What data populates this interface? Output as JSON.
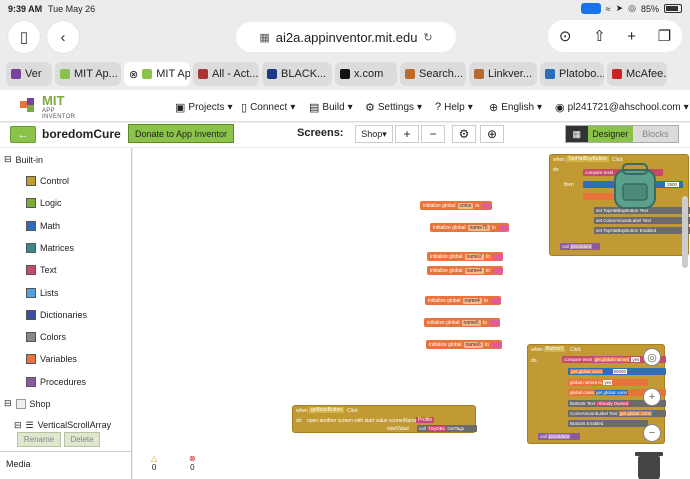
{
  "status": {
    "time": "9:39 AM",
    "date": "Tue May 26",
    "battery": "85%"
  },
  "browser": {
    "url": "ai2a.appinventor.mit.edu",
    "tabs": [
      {
        "label": "Ver",
        "color": "#7b3fa0",
        "close": false
      },
      {
        "label": "MIT Ap...",
        "color": "#8bc34a",
        "close": false
      },
      {
        "label": "MIT Ap...",
        "color": "#8bc34a",
        "close": true,
        "active": true
      },
      {
        "label": "All - Act...",
        "color": "#a33",
        "close": false
      },
      {
        "label": "BLACK...",
        "color": "#1a3a8a",
        "close": false
      },
      {
        "label": "x.com",
        "color": "#111",
        "close": false
      },
      {
        "label": "Search...",
        "color": "#c06a2a",
        "close": false
      },
      {
        "label": "Linkver...",
        "color": "#b86a2e",
        "close": false
      },
      {
        "label": "Platobo...",
        "color": "#2a6db8",
        "close": false
      },
      {
        "label": "McAfee...",
        "color": "#c22",
        "close": false
      }
    ]
  },
  "app": {
    "logo_title": "MIT",
    "logo_sub": "APP INVENTOR",
    "menu": {
      "projects": "Projects",
      "connect": "Connect",
      "build": "Build",
      "settings": "Settings",
      "help": "Help",
      "language": "English",
      "account": "pl241721@ahschool.com"
    },
    "project_name": "boredomCure",
    "donate": "Donate to App Inventor",
    "screens_label": "Screens:",
    "screen": "Shop",
    "designer": "Designer",
    "blocks": "Blocks"
  },
  "sidebar": {
    "builtin": "Built-in",
    "items": [
      {
        "label": "Control",
        "color": "#c29a34"
      },
      {
        "label": "Logic",
        "color": "#7cab3b"
      },
      {
        "label": "Math",
        "color": "#2f6db8"
      },
      {
        "label": "Matrices",
        "color": "#3a8a8a"
      },
      {
        "label": "Text",
        "color": "#c84a6a"
      },
      {
        "label": "Lists",
        "color": "#5aa0d8"
      },
      {
        "label": "Dictionaries",
        "color": "#3a4ea0"
      },
      {
        "label": "Colors",
        "color": "#888888"
      },
      {
        "label": "Variables",
        "color": "#e8743b"
      },
      {
        "label": "Procedures",
        "color": "#8e5a9e"
      }
    ],
    "shop": "Shop",
    "vsa": "VerticalScrollArray",
    "rename": "Rename",
    "delete": "Delete",
    "media": "Media"
  },
  "workspace": {
    "init_prefix": "initialize global",
    "to": "to",
    "globals": [
      "coins",
      "name75",
      "name2",
      "name4",
      "name4",
      "name5",
      "name6"
    ],
    "warnings": "0",
    "errors": "0",
    "evt1": {
      "when": "when",
      "comp": "TopHatBuyButton",
      "evt": "Click",
      "do": "do",
      "compare": "compare texts",
      "then": "then",
      "set": "set",
      "call": "call",
      "procedure": "procedure",
      "v": "2500",
      "r1": "TopHatBuyButton",
      "r1p": "Text",
      "r2": "CoinsAmountLabel",
      "r2p": "Text",
      "r3": "TopHatBuyButton",
      "r3p": "Enabled"
    },
    "evt2": {
      "when": "when",
      "comp": "Button5",
      "evt": "Click",
      "do": "do",
      "compare": "compare texts",
      "get1": "get global name5",
      "yes": "yes",
      "get2": "get global coins",
      "v": "50000",
      "set1": "global name5",
      "to": "to",
      "yes2": "yes",
      "set2": "global coins",
      "get3": "get global coins",
      "r1": "Button5",
      "r1p": "Text",
      "r1v": "Already Owned",
      "r2": "CoinsAmountLabel",
      "r2p": "Text",
      "r2v": "get global coins",
      "r3": "Button5",
      "r3p": "Enabled",
      "call": "call",
      "procedure": "procedure"
    },
    "evt3": {
      "when": "when",
      "comp": "goBackButton",
      "evt": "Click",
      "do": "do",
      "open": "open another screen with start value  screenName",
      "screen": "Profile",
      "start": "startValue",
      "call": "call",
      "tiny": "TinyDB1",
      "get": "GetTags"
    }
  }
}
